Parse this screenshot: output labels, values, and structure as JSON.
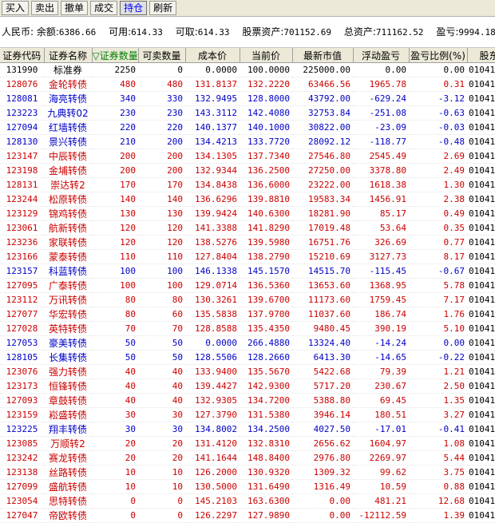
{
  "toolbar": {
    "buttons": [
      "买入",
      "卖出",
      "撤单",
      "成交",
      "持仓",
      "刷新"
    ],
    "active_index": 4
  },
  "summary": {
    "currency": "人民币:",
    "balance_label": "余额:",
    "balance": "6386.66",
    "available_label": "可用:",
    "available": "614.33",
    "withdrawable_label": "可取:",
    "withdrawable": "614.33",
    "stock_assets_label": "股票资产:",
    "stock_assets": "701152.69",
    "total_assets_label": "总资产:",
    "total_assets": "711162.52",
    "pnl_label": "盈亏:",
    "pnl": "9994.18"
  },
  "table": {
    "headers": [
      "证券代码",
      "证券名称",
      "证券数量",
      "可卖数量",
      "成本价",
      "当前价",
      "最新市值",
      "浮动盈亏",
      "盈亏比例(%)",
      "股东"
    ],
    "sorted_marker": "▽",
    "rows": [
      {
        "code": "131990",
        "name": "标准券",
        "qty": "2250",
        "sellable": "0",
        "cost": "0.0000",
        "price": "100.0000",
        "value": "225000.00",
        "pnl": "0.00",
        "pct": "0.00",
        "acct": "01041",
        "color": "black"
      },
      {
        "code": "128076",
        "name": "金轮转债",
        "qty": "480",
        "sellable": "480",
        "cost": "131.8137",
        "price": "132.2220",
        "value": "63466.56",
        "pnl": "1965.78",
        "pct": "0.31",
        "acct": "01041",
        "color": "red"
      },
      {
        "code": "128081",
        "name": "海亮转债",
        "qty": "340",
        "sellable": "330",
        "cost": "132.9495",
        "price": "128.8000",
        "value": "43792.00",
        "pnl": "-629.24",
        "pct": "-3.12",
        "acct": "01041",
        "color": "blue"
      },
      {
        "code": "123223",
        "name": "九典转02",
        "qty": "230",
        "sellable": "230",
        "cost": "143.3112",
        "price": "142.4080",
        "value": "32753.84",
        "pnl": "-251.08",
        "pct": "-0.63",
        "acct": "01041",
        "color": "blue"
      },
      {
        "code": "127094",
        "name": "红墙转债",
        "qty": "220",
        "sellable": "220",
        "cost": "140.1377",
        "price": "140.1000",
        "value": "30822.00",
        "pnl": "-23.09",
        "pct": "-0.03",
        "acct": "01041",
        "color": "blue"
      },
      {
        "code": "128130",
        "name": "景兴转债",
        "qty": "210",
        "sellable": "200",
        "cost": "134.4213",
        "price": "133.7720",
        "value": "28092.12",
        "pnl": "-118.77",
        "pct": "-0.48",
        "acct": "01041",
        "color": "blue"
      },
      {
        "code": "123147",
        "name": "中辰转债",
        "qty": "200",
        "sellable": "200",
        "cost": "134.1305",
        "price": "137.7340",
        "value": "27546.80",
        "pnl": "2545.49",
        "pct": "2.69",
        "acct": "01041",
        "color": "red"
      },
      {
        "code": "123198",
        "name": "金埔转债",
        "qty": "200",
        "sellable": "200",
        "cost": "132.9344",
        "price": "136.2500",
        "value": "27250.00",
        "pnl": "3378.80",
        "pct": "2.49",
        "acct": "01041",
        "color": "red"
      },
      {
        "code": "128131",
        "name": "崇达转2",
        "qty": "170",
        "sellable": "170",
        "cost": "134.8438",
        "price": "136.6000",
        "value": "23222.00",
        "pnl": "1618.38",
        "pct": "1.30",
        "acct": "01041",
        "color": "red"
      },
      {
        "code": "123244",
        "name": "松原转债",
        "qty": "140",
        "sellable": "140",
        "cost": "136.6296",
        "price": "139.8810",
        "value": "19583.34",
        "pnl": "1456.91",
        "pct": "2.38",
        "acct": "01041",
        "color": "red"
      },
      {
        "code": "123129",
        "name": "锦鸡转债",
        "qty": "130",
        "sellable": "130",
        "cost": "139.9424",
        "price": "140.6300",
        "value": "18281.90",
        "pnl": "85.17",
        "pct": "0.49",
        "acct": "01041",
        "color": "red"
      },
      {
        "code": "123061",
        "name": "航新转债",
        "qty": "120",
        "sellable": "120",
        "cost": "141.3388",
        "price": "141.8290",
        "value": "17019.48",
        "pnl": "53.64",
        "pct": "0.35",
        "acct": "01041",
        "color": "red"
      },
      {
        "code": "123236",
        "name": "家联转债",
        "qty": "120",
        "sellable": "120",
        "cost": "138.5276",
        "price": "139.5980",
        "value": "16751.76",
        "pnl": "326.69",
        "pct": "0.77",
        "acct": "01041",
        "color": "red"
      },
      {
        "code": "123166",
        "name": "蒙泰转债",
        "qty": "110",
        "sellable": "110",
        "cost": "127.8404",
        "price": "138.2790",
        "value": "15210.69",
        "pnl": "3127.73",
        "pct": "8.17",
        "acct": "01041",
        "color": "red"
      },
      {
        "code": "123157",
        "name": "科蓝转债",
        "qty": "100",
        "sellable": "100",
        "cost": "146.1338",
        "price": "145.1570",
        "value": "14515.70",
        "pnl": "-115.45",
        "pct": "-0.67",
        "acct": "01041",
        "color": "blue"
      },
      {
        "code": "127095",
        "name": "广泰转债",
        "qty": "100",
        "sellable": "100",
        "cost": "129.0714",
        "price": "136.5360",
        "value": "13653.60",
        "pnl": "1368.95",
        "pct": "5.78",
        "acct": "01041",
        "color": "red"
      },
      {
        "code": "123112",
        "name": "万讯转债",
        "qty": "80",
        "sellable": "80",
        "cost": "130.3261",
        "price": "139.6700",
        "value": "11173.60",
        "pnl": "1759.45",
        "pct": "7.17",
        "acct": "01041",
        "color": "red"
      },
      {
        "code": "127077",
        "name": "华宏转债",
        "qty": "80",
        "sellable": "60",
        "cost": "135.5838",
        "price": "137.9700",
        "value": "11037.60",
        "pnl": "186.74",
        "pct": "1.76",
        "acct": "01041",
        "color": "red"
      },
      {
        "code": "127028",
        "name": "英特转债",
        "qty": "70",
        "sellable": "70",
        "cost": "128.8588",
        "price": "135.4350",
        "value": "9480.45",
        "pnl": "390.19",
        "pct": "5.10",
        "acct": "01041",
        "color": "red"
      },
      {
        "code": "127053",
        "name": "豪美转债",
        "qty": "50",
        "sellable": "50",
        "cost": "0.0000",
        "price": "266.4880",
        "value": "13324.40",
        "pnl": "-14.24",
        "pct": "0.00",
        "acct": "01041",
        "color": "blue"
      },
      {
        "code": "128105",
        "name": "长集转债",
        "qty": "50",
        "sellable": "50",
        "cost": "128.5506",
        "price": "128.2660",
        "value": "6413.30",
        "pnl": "-14.65",
        "pct": "-0.22",
        "acct": "01041",
        "color": "blue"
      },
      {
        "code": "123076",
        "name": "强力转债",
        "qty": "40",
        "sellable": "40",
        "cost": "133.9400",
        "price": "135.5670",
        "value": "5422.68",
        "pnl": "79.39",
        "pct": "1.21",
        "acct": "01041",
        "color": "red"
      },
      {
        "code": "123173",
        "name": "恒锋转债",
        "qty": "40",
        "sellable": "40",
        "cost": "139.4427",
        "price": "142.9300",
        "value": "5717.20",
        "pnl": "230.67",
        "pct": "2.50",
        "acct": "01041",
        "color": "red"
      },
      {
        "code": "127093",
        "name": "章鼓转债",
        "qty": "40",
        "sellable": "40",
        "cost": "132.9305",
        "price": "134.7200",
        "value": "5388.80",
        "pnl": "69.45",
        "pct": "1.35",
        "acct": "01041",
        "color": "red"
      },
      {
        "code": "123159",
        "name": "崧盛转债",
        "qty": "30",
        "sellable": "30",
        "cost": "127.3790",
        "price": "131.5380",
        "value": "3946.14",
        "pnl": "180.51",
        "pct": "3.27",
        "acct": "01041",
        "color": "red"
      },
      {
        "code": "123225",
        "name": "翔丰转债",
        "qty": "30",
        "sellable": "30",
        "cost": "134.8002",
        "price": "134.2500",
        "value": "4027.50",
        "pnl": "-17.01",
        "pct": "-0.41",
        "acct": "01041",
        "color": "blue"
      },
      {
        "code": "123085",
        "name": "万顺转2",
        "qty": "20",
        "sellable": "20",
        "cost": "131.4120",
        "price": "132.8310",
        "value": "2656.62",
        "pnl": "1604.97",
        "pct": "1.08",
        "acct": "01041",
        "color": "red"
      },
      {
        "code": "123242",
        "name": "赛龙转债",
        "qty": "20",
        "sellable": "20",
        "cost": "141.1644",
        "price": "148.8400",
        "value": "2976.80",
        "pnl": "2269.97",
        "pct": "5.44",
        "acct": "01041",
        "color": "red"
      },
      {
        "code": "123138",
        "name": "丝路转债",
        "qty": "10",
        "sellable": "10",
        "cost": "126.2000",
        "price": "130.9320",
        "value": "1309.32",
        "pnl": "99.62",
        "pct": "3.75",
        "acct": "01041",
        "color": "red"
      },
      {
        "code": "127099",
        "name": "盛航转债",
        "qty": "10",
        "sellable": "10",
        "cost": "130.5000",
        "price": "131.6490",
        "value": "1316.49",
        "pnl": "10.59",
        "pct": "0.88",
        "acct": "01041",
        "color": "red"
      },
      {
        "code": "123054",
        "name": "思特转债",
        "qty": "0",
        "sellable": "0",
        "cost": "145.2103",
        "price": "163.6300",
        "value": "0.00",
        "pnl": "481.21",
        "pct": "12.68",
        "acct": "01041",
        "color": "red"
      },
      {
        "code": "127047",
        "name": "帝欧转债",
        "qty": "0",
        "sellable": "0",
        "cost": "126.2297",
        "price": "127.9890",
        "value": "0.00",
        "pnl": "-12112.59",
        "pct": "1.39",
        "acct": "01041",
        "color": "red"
      }
    ]
  }
}
